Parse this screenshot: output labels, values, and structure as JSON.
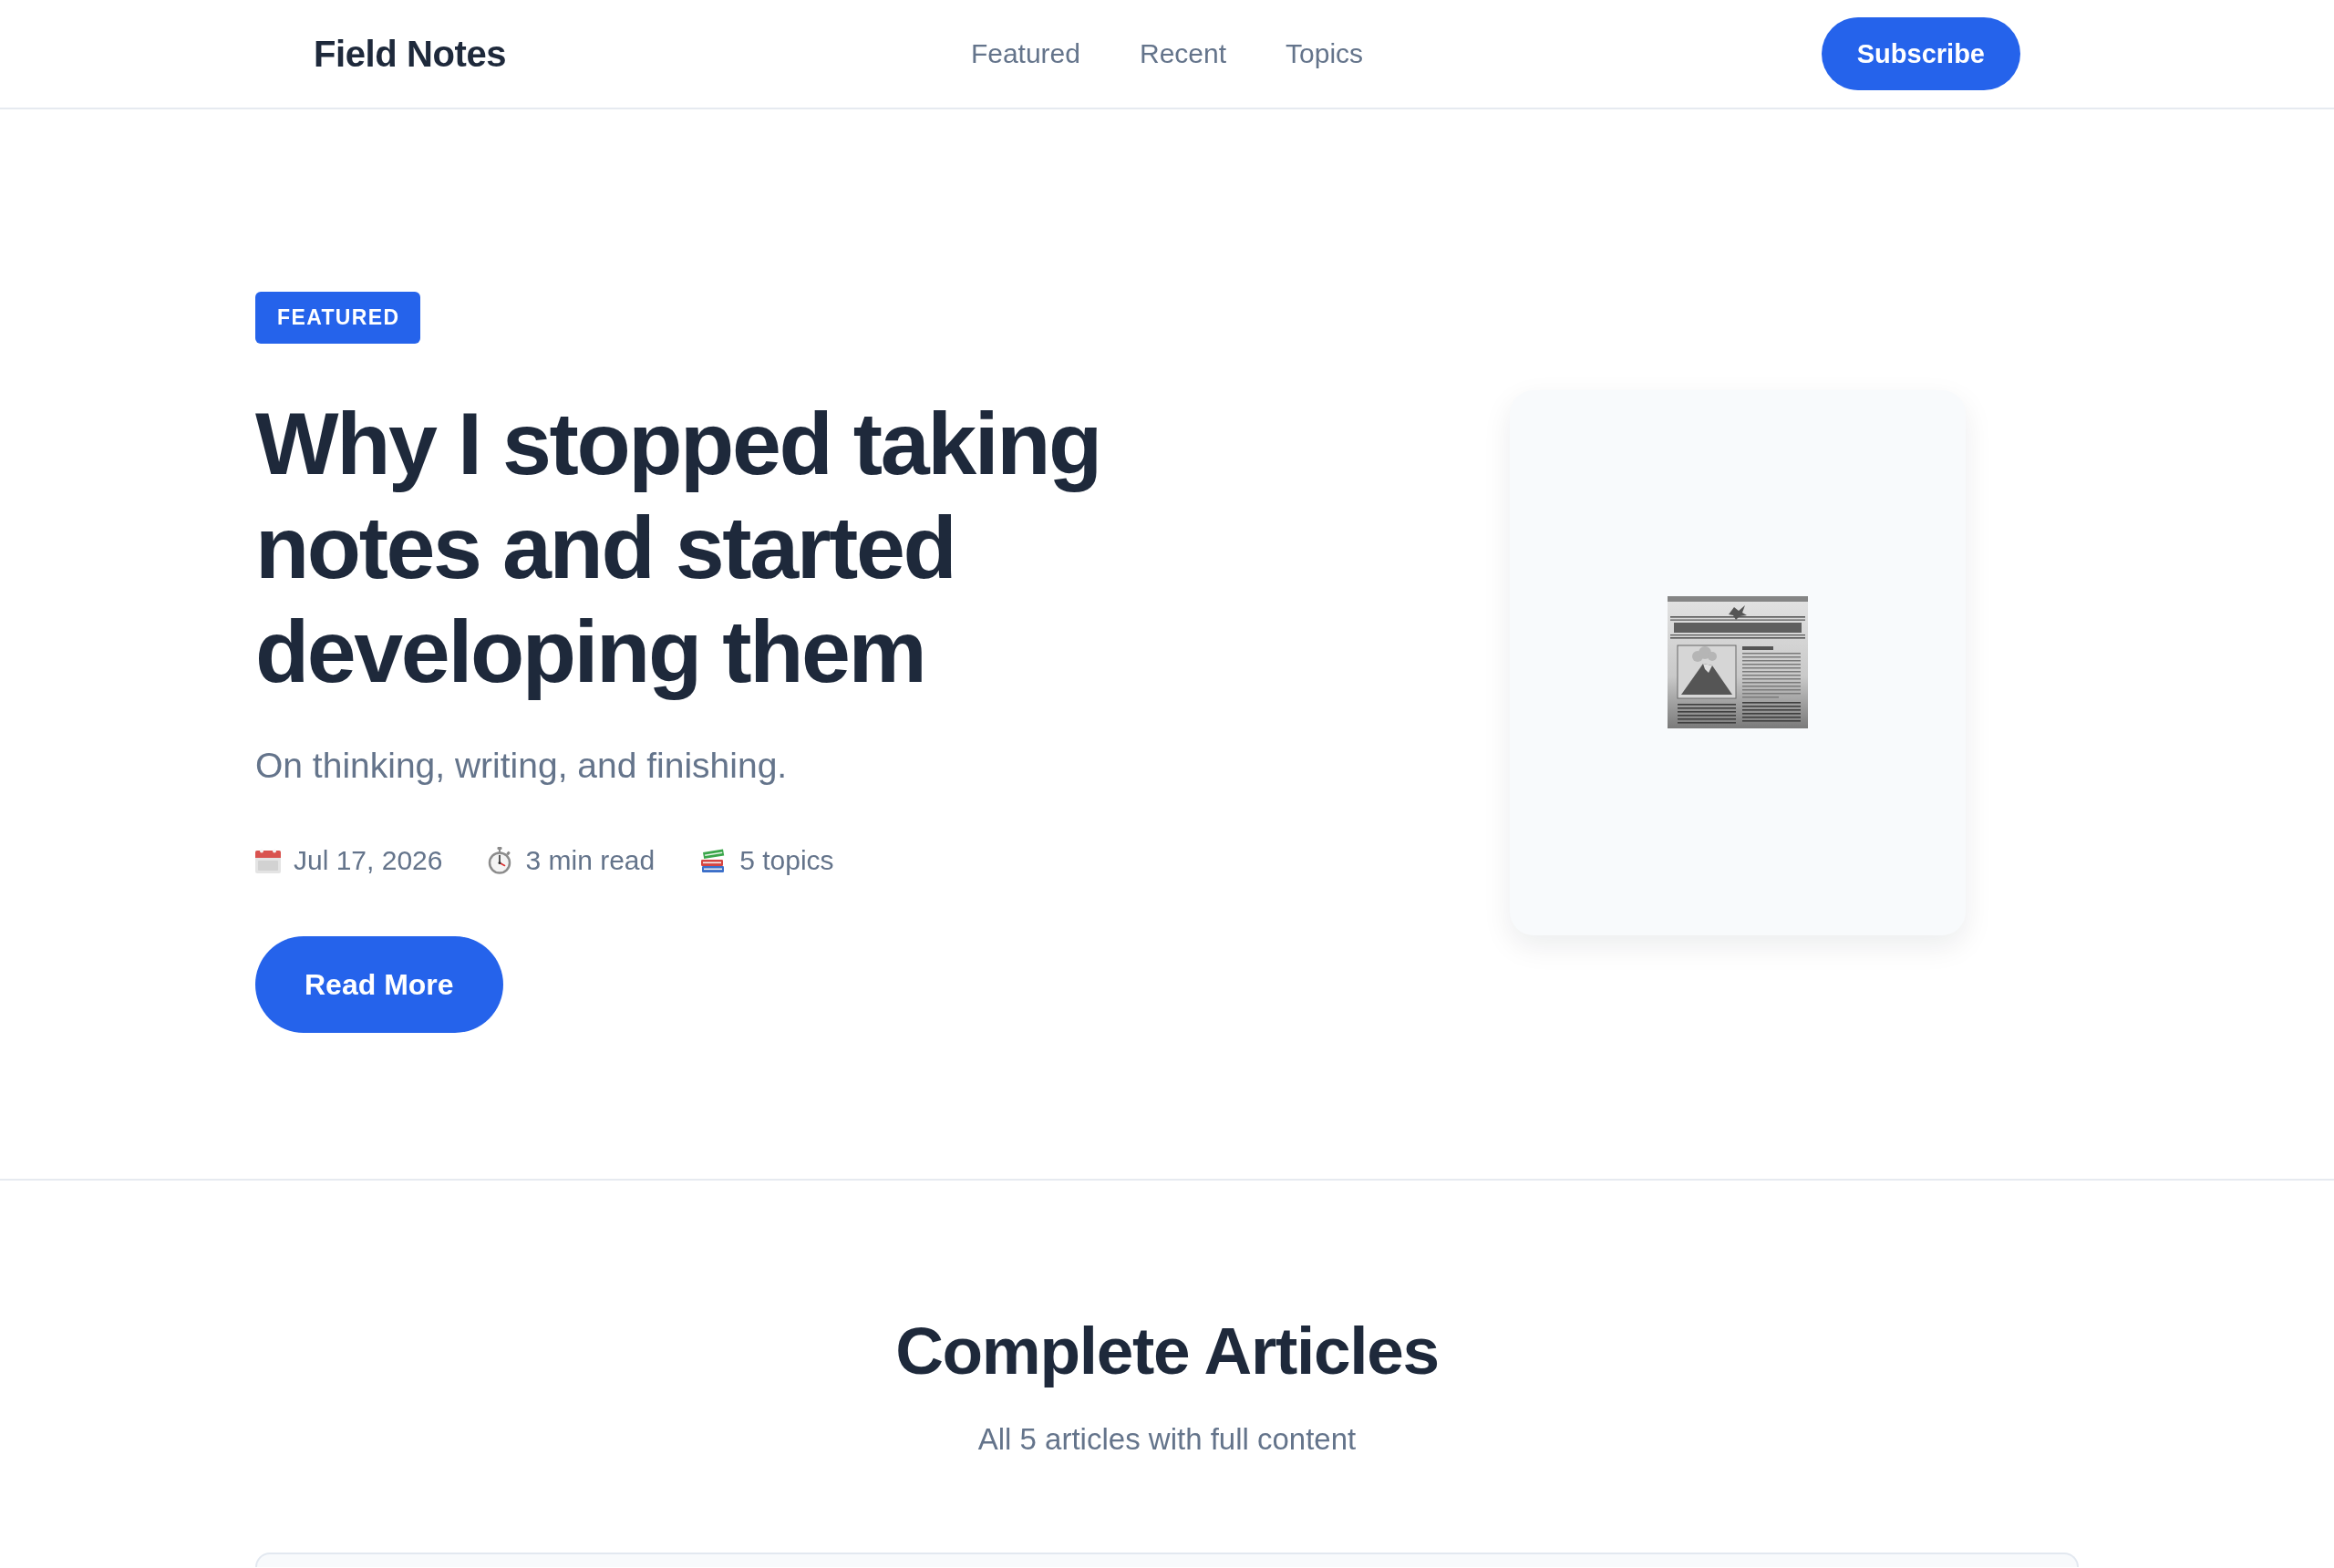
{
  "header": {
    "logo": "Field Notes",
    "nav": [
      "Featured",
      "Recent",
      "Topics"
    ],
    "subscribe_button": "Subscribe"
  },
  "hero": {
    "tag": "FEATURED",
    "title": "Why I stopped taking notes and started developing them",
    "subtitle": "On thinking, writing, and finishing.",
    "meta": [
      {
        "kind": "date",
        "text": "Jul 17, 2026"
      },
      {
        "kind": "read_time",
        "text": "3 min read"
      },
      {
        "kind": "topics",
        "text": "5 topics"
      }
    ],
    "button": "Read More"
  },
  "articles": {
    "title": "Complete Articles",
    "subtitle": "All 5 articles with full content"
  }
}
